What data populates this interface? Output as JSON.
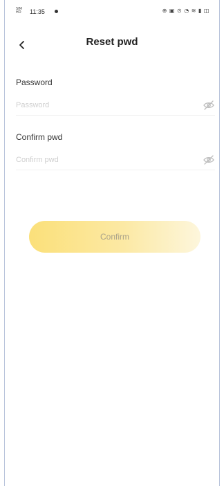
{
  "status_bar": {
    "carrier": "SIM\nHD",
    "time": "11:35",
    "icons_text": "⊕ ▣ ⊙ ◔ ≋ ▮ ◫"
  },
  "header": {
    "title": "Reset pwd",
    "back_icon": "chevron-left-icon"
  },
  "form": {
    "password": {
      "label": "Password",
      "placeholder": "Password",
      "value": ""
    },
    "confirm": {
      "label": "Confirm pwd",
      "placeholder": "Confirm pwd",
      "value": ""
    },
    "toggle_icon": "eye-off-icon"
  },
  "actions": {
    "confirm_label": "Confirm"
  },
  "colors": {
    "button_gradient_start": "#fbe07a",
    "button_gradient_end": "#fdf6dc",
    "button_text": "#a9a28a",
    "placeholder": "#cfcfcf"
  }
}
